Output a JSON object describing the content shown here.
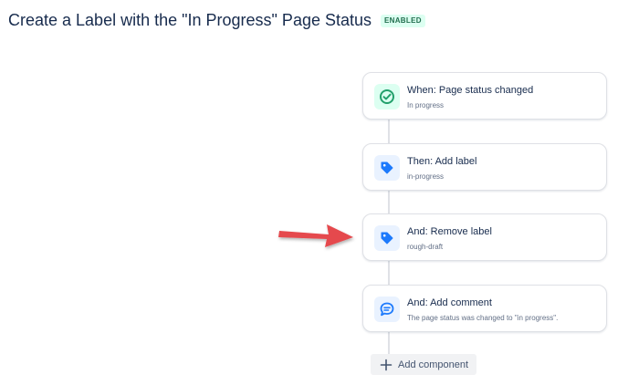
{
  "header": {
    "title": "Create a Label with the \"In Progress\" Page Status",
    "status_badge": "ENABLED"
  },
  "flow": {
    "components": [
      {
        "title": "When: Page status changed",
        "subtitle": "In progress",
        "icon": "check-circle-icon",
        "kind": "trigger"
      },
      {
        "title": "Then: Add label",
        "subtitle": "in-progress",
        "icon": "tag-icon",
        "kind": "action"
      },
      {
        "title": "And: Remove label",
        "subtitle": "rough-draft",
        "icon": "tag-icon",
        "kind": "action"
      },
      {
        "title": "And: Add comment",
        "subtitle": "The page status was changed to \"in progress\".",
        "icon": "comment-icon",
        "kind": "action"
      }
    ],
    "add_component_label": "Add component"
  },
  "annotation": {
    "icon": "red-arrow-icon",
    "color": "#e5484d"
  },
  "colors": {
    "trigger_icon": "#22a06b",
    "action_icon": "#1d7afc",
    "badge_text": "#216e4e",
    "badge_bg": "#dcfff1"
  }
}
